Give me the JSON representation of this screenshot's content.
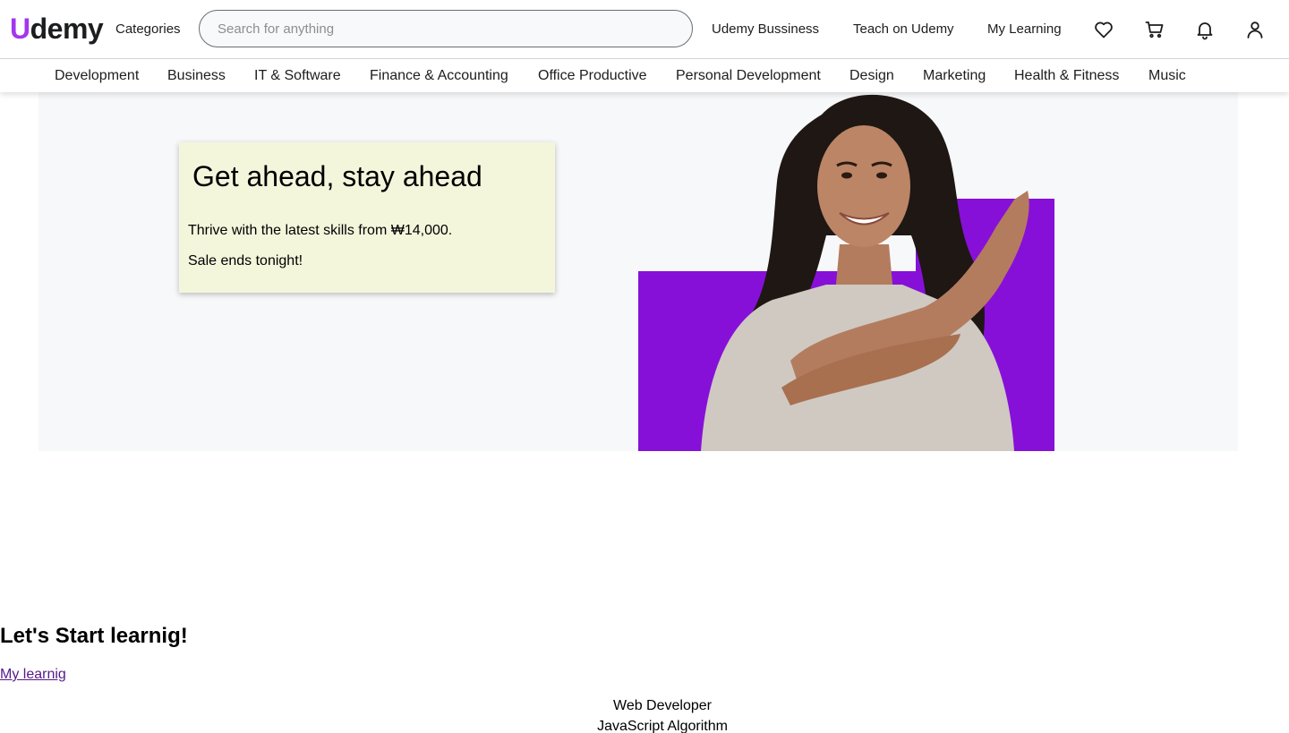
{
  "header": {
    "logo_first": "U",
    "logo_rest": "demy",
    "categories_label": "Categories",
    "search_placeholder": "Search for anything",
    "search_value": "",
    "links": [
      "Udemy Bussiness",
      "Teach on Udemy",
      "My Learning"
    ],
    "icons": [
      "heart-icon",
      "cart-icon",
      "bell-icon",
      "user-icon"
    ]
  },
  "category_nav": [
    "Development",
    "Business",
    "IT & Software",
    "Finance & Accounting",
    "Office Productive",
    "Personal Development",
    "Design",
    "Marketing",
    "Health & Fitness",
    "Music"
  ],
  "hero": {
    "title": "Get ahead, stay ahead",
    "line1": "Thrive with the latest skills from ₩14,000.",
    "line2": "Sale ends tonight!"
  },
  "learning": {
    "title": "Let's Start learnig!",
    "link": "My learnig",
    "courses": [
      "Web Developer",
      "JavaScript Algorithm"
    ]
  },
  "colors": {
    "brand": "#a435f0",
    "hero_accent": "#8710d8",
    "promo_bg": "#f4f6dc",
    "link_visited": "#551a8b"
  }
}
